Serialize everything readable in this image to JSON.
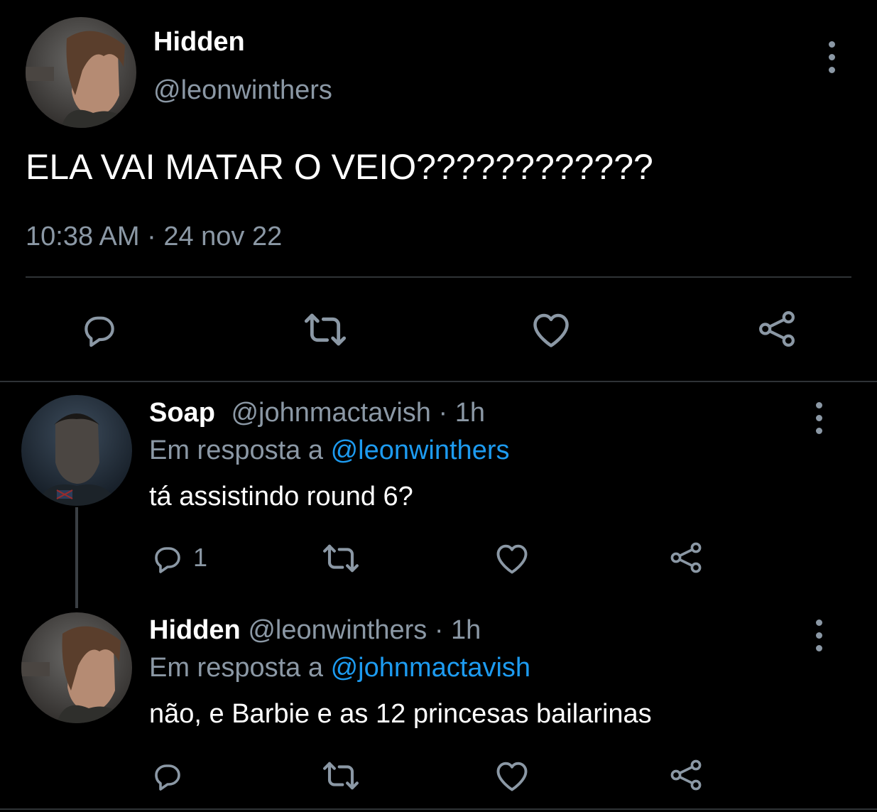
{
  "main_tweet": {
    "display_name": "Hidden",
    "handle": "@leonwinthers",
    "text": "ELA VAI MATAR O VEIO????????????",
    "time": "10:38 AM",
    "separator": "·",
    "date": "24 nov 22"
  },
  "replies": [
    {
      "display_name": "Soap",
      "handle": "@johnmactavish",
      "separator": "·",
      "time": "1h",
      "reply_prefix": "Em resposta a",
      "reply_to": "@leonwinthers",
      "text": "tá assistindo round 6?",
      "reply_count": "1"
    },
    {
      "display_name": "Hidden",
      "handle": "@leonwinthers",
      "separator": "·",
      "time": "1h",
      "reply_prefix": "Em resposta a",
      "reply_to": "@johnmactavish",
      "text": "não, e Barbie e as 12 princesas bailarinas",
      "reply_count": ""
    }
  ],
  "icons": [
    "reply-icon",
    "retweet-icon",
    "like-icon",
    "share-icon",
    "more-icon"
  ],
  "colors": {
    "background": "#000000",
    "text": "#e7e9ea",
    "muted": "#8b98a5",
    "link": "#1d9bf0",
    "divider": "#2f3336"
  }
}
